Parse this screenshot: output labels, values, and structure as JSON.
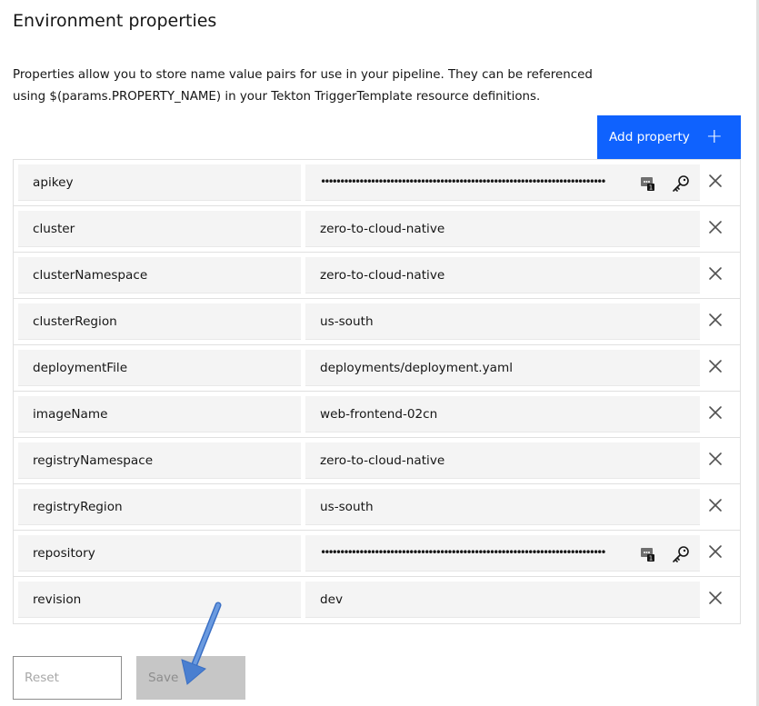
{
  "page": {
    "title": "Environment properties",
    "description": "Properties allow you to store name value pairs for use in your pipeline. They can be referenced using $(params.PROPERTY_NAME) in your Tekton TriggerTemplate resource definitions."
  },
  "toolbar": {
    "add_label": "Add property",
    "add_icon": "plus-icon"
  },
  "properties": [
    {
      "name": "apikey",
      "value": "••••••••••••••••••••••••••••••••••••••••••••••••••••••••••••••••••••••••••",
      "secure": true
    },
    {
      "name": "cluster",
      "value": "zero-to-cloud-native",
      "secure": false
    },
    {
      "name": "clusterNamespace",
      "value": "zero-to-cloud-native",
      "secure": false
    },
    {
      "name": "clusterRegion",
      "value": "us-south",
      "secure": false
    },
    {
      "name": "deploymentFile",
      "value": "deployments/deployment.yaml",
      "secure": false
    },
    {
      "name": "imageName",
      "value": "web-frontend-02cn",
      "secure": false
    },
    {
      "name": "registryNamespace",
      "value": "zero-to-cloud-native",
      "secure": false
    },
    {
      "name": "registryRegion",
      "value": "us-south",
      "secure": false
    },
    {
      "name": "repository",
      "value": "••••••••••••••••••••••••••••••••••••••••••••••••••••••••••••••••••••••••••",
      "secure": true
    },
    {
      "name": "revision",
      "value": "dev",
      "secure": false
    }
  ],
  "icons": {
    "vault": "secret-vault-icon",
    "key": "key-icon",
    "remove": "close-icon"
  },
  "footer": {
    "reset_label": "Reset",
    "save_label": "Save"
  },
  "colors": {
    "primary": "#0f62fe",
    "field_bg": "#f4f4f4",
    "disabled_bg": "#c6c6c6",
    "annotation_arrow": "#5a8fd6"
  }
}
